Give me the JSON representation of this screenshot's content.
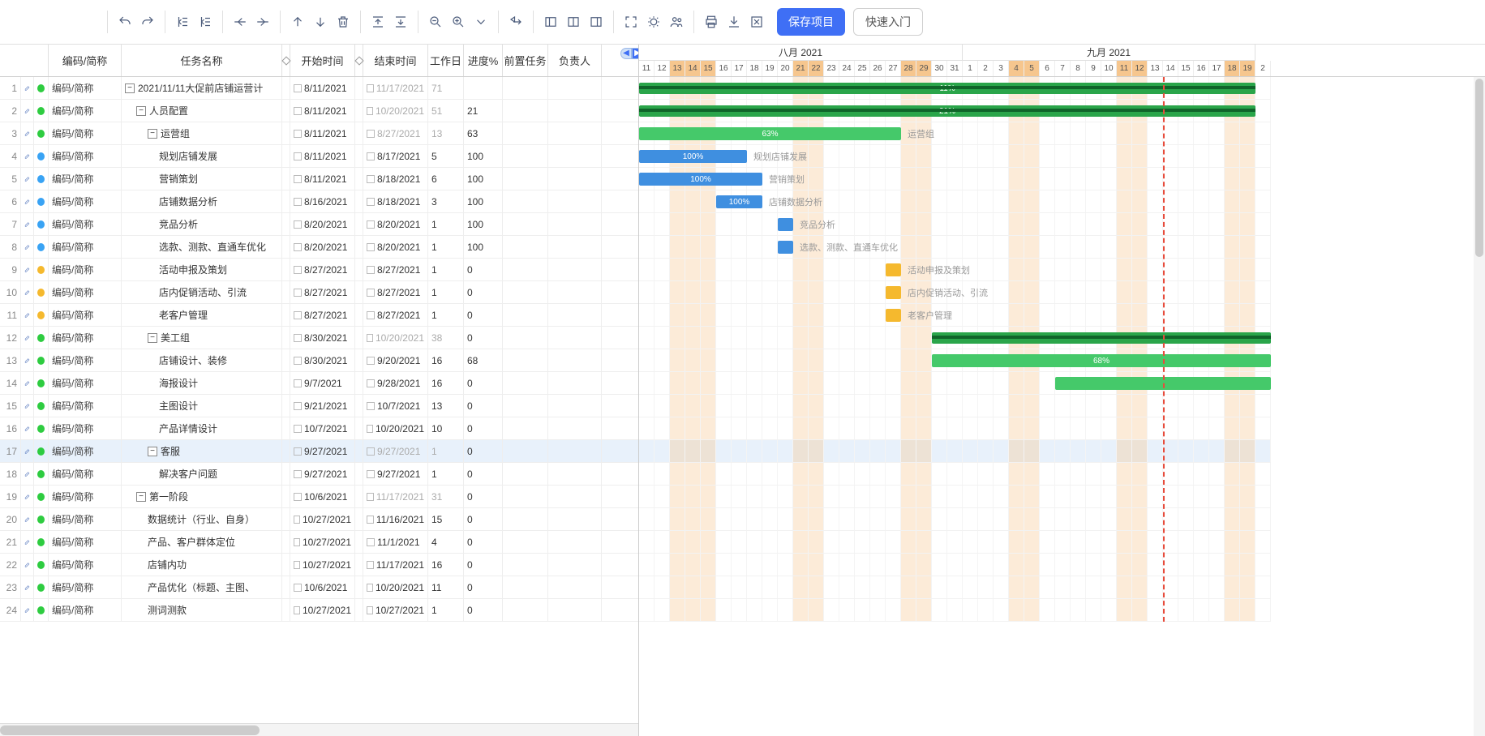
{
  "toolbar": {
    "save_label": "保存项目",
    "quick_start_label": "快速入门"
  },
  "columns": {
    "code": "编码/简称",
    "name": "任务名称",
    "start": "开始时间",
    "end": "结束时间",
    "days": "工作日",
    "progress": "进度%",
    "pred": "前置任务",
    "owner": "负责人"
  },
  "timeline": {
    "months": [
      {
        "label": "八月 2021",
        "span": 21
      },
      {
        "label": "九月 2021",
        "span": 19
      }
    ],
    "days": [
      {
        "n": "11"
      },
      {
        "n": "12"
      },
      {
        "n": "13",
        "hl": true
      },
      {
        "n": "14",
        "hl": true
      },
      {
        "n": "15",
        "hl": true
      },
      {
        "n": "16"
      },
      {
        "n": "17"
      },
      {
        "n": "18"
      },
      {
        "n": "19"
      },
      {
        "n": "20"
      },
      {
        "n": "21",
        "hl": true
      },
      {
        "n": "22",
        "hl": true
      },
      {
        "n": "23"
      },
      {
        "n": "24"
      },
      {
        "n": "25"
      },
      {
        "n": "26"
      },
      {
        "n": "27"
      },
      {
        "n": "28",
        "hl": true
      },
      {
        "n": "29",
        "hl": true
      },
      {
        "n": "30"
      },
      {
        "n": "31"
      },
      {
        "n": "1"
      },
      {
        "n": "2"
      },
      {
        "n": "3"
      },
      {
        "n": "4",
        "hl": true
      },
      {
        "n": "5",
        "hl": true
      },
      {
        "n": "6"
      },
      {
        "n": "7"
      },
      {
        "n": "8"
      },
      {
        "n": "9"
      },
      {
        "n": "10"
      },
      {
        "n": "11",
        "hl": true
      },
      {
        "n": "12",
        "hl": true
      },
      {
        "n": "13"
      },
      {
        "n": "14"
      },
      {
        "n": "15"
      },
      {
        "n": "16"
      },
      {
        "n": "17"
      },
      {
        "n": "18",
        "hl": true
      },
      {
        "n": "19",
        "hl": true
      },
      {
        "n": "2"
      }
    ],
    "today_index": 34
  },
  "rows": [
    {
      "num": 1,
      "dot": "green",
      "code": "编码/简称",
      "indent": 0,
      "collapse": "-",
      "name": "2021/11/11大促前店铺运营计",
      "start": "8/11/2021",
      "end": "11/17/2021",
      "end_muted": true,
      "days": "71",
      "days_muted": true,
      "prog": "",
      "bar": {
        "type": "summary",
        "start": 0,
        "span": 40,
        "pct": "11%"
      }
    },
    {
      "num": 2,
      "dot": "green",
      "code": "编码/简称",
      "indent": 1,
      "collapse": "-",
      "name": "人员配置",
      "start": "8/11/2021",
      "end": "10/20/2021",
      "end_muted": true,
      "days": "51",
      "days_muted": true,
      "prog": "21",
      "bar": {
        "type": "summary",
        "start": 0,
        "span": 40,
        "pct": "21%"
      }
    },
    {
      "num": 3,
      "dot": "green",
      "code": "编码/简称",
      "indent": 2,
      "collapse": "-",
      "name": "运营组",
      "start": "8/11/2021",
      "end": "8/27/2021",
      "end_muted": true,
      "days": "13",
      "days_muted": true,
      "prog": "63",
      "bar": {
        "type": "group",
        "start": 0,
        "span": 17,
        "pct": "63%",
        "label": "运营组"
      }
    },
    {
      "num": 4,
      "dot": "blue",
      "code": "编码/简称",
      "indent": 3,
      "name": "规划店铺发展",
      "start": "8/11/2021",
      "end": "8/17/2021",
      "days": "5",
      "prog": "100",
      "bar": {
        "type": "task",
        "start": 0,
        "span": 7,
        "pct": "100%",
        "label": "规划店铺发展"
      }
    },
    {
      "num": 5,
      "dot": "blue",
      "code": "编码/简称",
      "indent": 3,
      "name": "营销策划",
      "start": "8/11/2021",
      "end": "8/18/2021",
      "days": "6",
      "prog": "100",
      "bar": {
        "type": "task",
        "start": 0,
        "span": 8,
        "pct": "100%",
        "label": "营销策划"
      }
    },
    {
      "num": 6,
      "dot": "blue",
      "code": "编码/简称",
      "indent": 3,
      "name": "店铺数据分析",
      "start": "8/16/2021",
      "end": "8/18/2021",
      "days": "3",
      "prog": "100",
      "bar": {
        "type": "task",
        "start": 5,
        "span": 3,
        "pct": "100%",
        "label": "店铺数据分析"
      }
    },
    {
      "num": 7,
      "dot": "blue",
      "code": "编码/简称",
      "indent": 3,
      "name": "竞品分析",
      "start": "8/20/2021",
      "end": "8/20/2021",
      "days": "1",
      "prog": "100",
      "bar": {
        "type": "task",
        "start": 9,
        "span": 1,
        "label": "竞品分析"
      }
    },
    {
      "num": 8,
      "dot": "blue",
      "code": "编码/简称",
      "indent": 3,
      "name": "选款、测款、直通车优化",
      "start": "8/20/2021",
      "end": "8/20/2021",
      "days": "1",
      "prog": "100",
      "bar": {
        "type": "task",
        "start": 9,
        "span": 1,
        "label": "选款、测款、直通车优化"
      }
    },
    {
      "num": 9,
      "dot": "orange",
      "code": "编码/简称",
      "indent": 3,
      "name": "活动申报及策划",
      "start": "8/27/2021",
      "end": "8/27/2021",
      "days": "1",
      "prog": "0",
      "bar": {
        "type": "pending",
        "start": 16,
        "span": 1,
        "label": "活动申报及策划"
      }
    },
    {
      "num": 10,
      "dot": "orange",
      "code": "编码/简称",
      "indent": 3,
      "name": "店内促销活动、引流",
      "start": "8/27/2021",
      "end": "8/27/2021",
      "days": "1",
      "prog": "0",
      "bar": {
        "type": "pending",
        "start": 16,
        "span": 1,
        "label": "店内促销活动、引流"
      }
    },
    {
      "num": 11,
      "dot": "orange",
      "code": "编码/简称",
      "indent": 3,
      "name": "老客户管理",
      "start": "8/27/2021",
      "end": "8/27/2021",
      "days": "1",
      "prog": "0",
      "bar": {
        "type": "pending",
        "start": 16,
        "span": 1,
        "label": "老客户管理"
      }
    },
    {
      "num": 12,
      "dot": "green",
      "code": "编码/简称",
      "indent": 2,
      "collapse": "-",
      "name": "美工组",
      "start": "8/30/2021",
      "end": "10/20/2021",
      "end_muted": true,
      "days": "38",
      "days_muted": true,
      "prog": "0",
      "bar": {
        "type": "summary",
        "start": 19,
        "span": 40
      }
    },
    {
      "num": 13,
      "dot": "green",
      "code": "编码/简称",
      "indent": 3,
      "name": "店铺设计、装修",
      "start": "8/30/2021",
      "end": "9/20/2021",
      "days": "16",
      "prog": "68",
      "bar": {
        "type": "green",
        "start": 19,
        "span": 40,
        "pct": "68%"
      }
    },
    {
      "num": 14,
      "dot": "green",
      "code": "编码/简称",
      "indent": 3,
      "name": "海报设计",
      "start": "9/7/2021",
      "end": "9/28/2021",
      "days": "16",
      "prog": "0",
      "bar": {
        "type": "green",
        "start": 27,
        "span": 40
      }
    },
    {
      "num": 15,
      "dot": "green",
      "code": "编码/简称",
      "indent": 3,
      "name": "主图设计",
      "start": "9/21/2021",
      "end": "10/7/2021",
      "days": "13",
      "prog": "0"
    },
    {
      "num": 16,
      "dot": "green",
      "code": "编码/简称",
      "indent": 3,
      "name": "产品详情设计",
      "start": "10/7/2021",
      "end": "10/20/2021",
      "days": "10",
      "prog": "0"
    },
    {
      "num": 17,
      "dot": "green",
      "code": "编码/简称",
      "indent": 2,
      "collapse": "-",
      "name": "客服",
      "start": "9/27/2021",
      "end": "9/27/2021",
      "end_muted": true,
      "days": "1",
      "days_muted": true,
      "prog": "0",
      "highlight": true
    },
    {
      "num": 18,
      "dot": "green",
      "code": "编码/简称",
      "indent": 3,
      "name": "解决客户问题",
      "start": "9/27/2021",
      "end": "9/27/2021",
      "days": "1",
      "prog": "0"
    },
    {
      "num": 19,
      "dot": "green",
      "code": "编码/简称",
      "indent": 1,
      "collapse": "-",
      "name": "第一阶段",
      "start": "10/6/2021",
      "end": "11/17/2021",
      "end_muted": true,
      "days": "31",
      "days_muted": true,
      "prog": "0"
    },
    {
      "num": 20,
      "dot": "green",
      "code": "编码/简称",
      "indent": 2,
      "name": "数据统计（行业、自身）",
      "start": "10/27/2021",
      "end": "11/16/2021",
      "days": "15",
      "prog": "0"
    },
    {
      "num": 21,
      "dot": "green",
      "code": "编码/简称",
      "indent": 2,
      "name": "产品、客户群体定位",
      "start": "10/27/2021",
      "end": "11/1/2021",
      "days": "4",
      "prog": "0"
    },
    {
      "num": 22,
      "dot": "green",
      "code": "编码/简称",
      "indent": 2,
      "name": "店铺内功",
      "start": "10/27/2021",
      "end": "11/17/2021",
      "days": "16",
      "prog": "0"
    },
    {
      "num": 23,
      "dot": "green",
      "code": "编码/简称",
      "indent": 2,
      "name": "产品优化（标题、主图、",
      "start": "10/6/2021",
      "end": "10/20/2021",
      "days": "11",
      "prog": "0"
    },
    {
      "num": 24,
      "dot": "green",
      "code": "编码/简称",
      "indent": 2,
      "name": "测词测款",
      "start": "10/27/2021",
      "end": "10/27/2021",
      "days": "1",
      "prog": "0"
    }
  ]
}
